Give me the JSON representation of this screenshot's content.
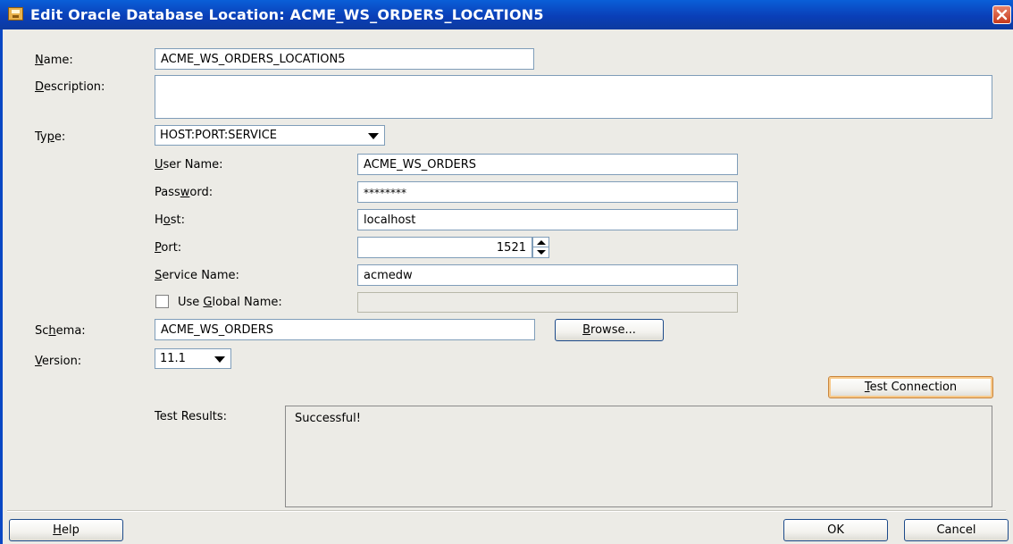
{
  "window": {
    "title": "Edit Oracle Database Location: ACME_WS_ORDERS_LOCATION5",
    "title_color": "#0a47c4"
  },
  "form": {
    "name": {
      "label_mnemonic": "N",
      "label_rest": "ame:",
      "value": "ACME_WS_ORDERS_LOCATION5"
    },
    "description": {
      "label_mnemonic": "D",
      "label_rest": "escription:",
      "value": ""
    },
    "type": {
      "label_pre": "Ty",
      "label_mnemonic": "p",
      "label_rest": "e:",
      "value": "HOST:PORT:SERVICE"
    },
    "user_name": {
      "label_mnemonic": "U",
      "label_rest": "ser Name:",
      "value": "ACME_WS_ORDERS"
    },
    "password": {
      "label_pre": "Pass",
      "label_mnemonic": "w",
      "label_rest": "ord:",
      "value": "********"
    },
    "host": {
      "label_pre": "H",
      "label_mnemonic": "o",
      "label_rest": "st:",
      "value": "localhost"
    },
    "port": {
      "label_mnemonic": "P",
      "label_rest": "ort:",
      "value": "1521"
    },
    "service_name": {
      "label_mnemonic": "S",
      "label_rest": "ervice Name:",
      "value": "acmedw"
    },
    "use_global_name": {
      "label_pre": "Use ",
      "label_mnemonic": "G",
      "label_rest": "lobal Name:",
      "checked": false,
      "value": ""
    },
    "schema": {
      "label_pre": "Sc",
      "label_mnemonic": "h",
      "label_rest": "ema:",
      "value": "ACME_WS_ORDERS"
    },
    "version": {
      "label_mnemonic": "V",
      "label_rest": "ersion:",
      "value": "11.1"
    },
    "browse_button": {
      "label_mnemonic": "B",
      "label_rest": "rowse..."
    },
    "test_connection_button": {
      "label_mnemonic": "T",
      "label_rest": "est Connection"
    },
    "test_results": {
      "label": "Test Results:",
      "value": "Successful!"
    }
  },
  "footer": {
    "help_button": {
      "label_mnemonic": "H",
      "label_rest": "elp"
    },
    "ok_button": {
      "label": "OK"
    },
    "cancel_button": {
      "label": "Cancel"
    }
  },
  "icons": {
    "app": "database-location-icon",
    "close": "close-icon",
    "dropdown": "chevron-down-icon",
    "spin_up": "arrow-up-icon",
    "spin_down": "arrow-down-icon"
  },
  "colors": {
    "titlebar": "#0a47c4",
    "background": "#ecebe6",
    "field_border": "#7f9db9",
    "close_button": "#d1502e",
    "focus_border": "#c9853c"
  }
}
